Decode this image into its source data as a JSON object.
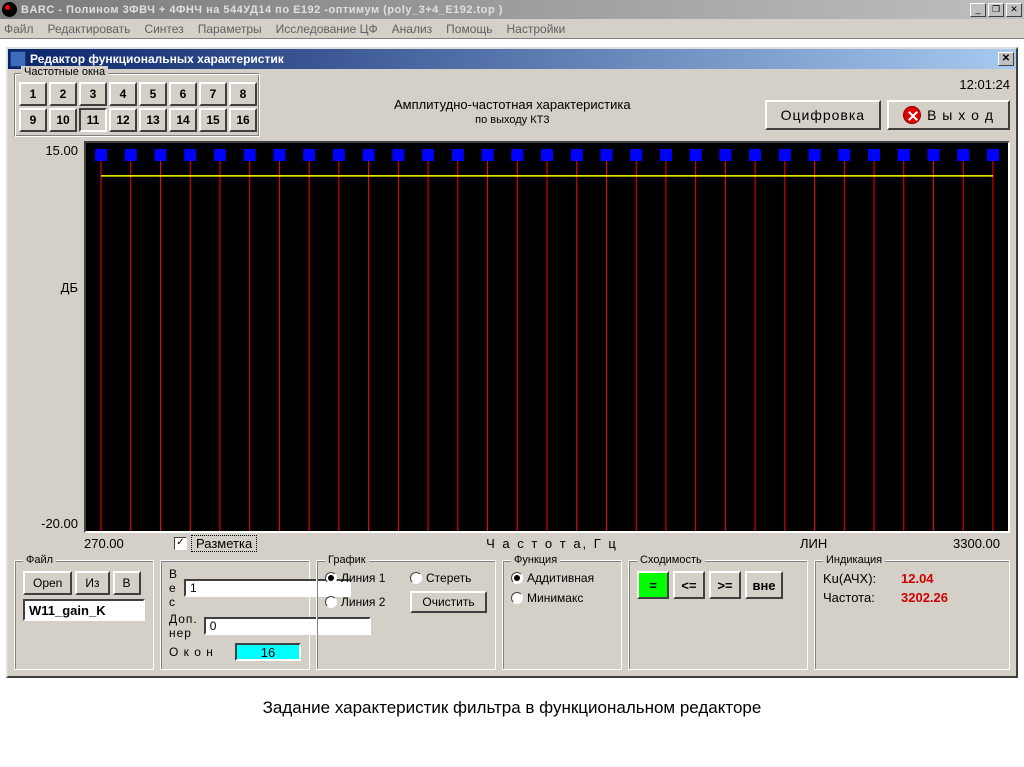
{
  "app_title": "BARC  -  Полином 3ФВЧ + 4ФНЧ на 544УД14 по Е192 -оптимум (poly_3+4_E192.top )",
  "menu": [
    "Файл",
    "Редактировать",
    "Синтез",
    "Параметры",
    "Исследование ЦФ",
    "Анализ",
    "Помощь",
    "Настройки"
  ],
  "editor_title": "Редактор функциональных характеристик",
  "freq_windows_label": "Частотные окна",
  "freq_windows": [
    "1",
    "2",
    "3",
    "4",
    "5",
    "6",
    "7",
    "8",
    "9",
    "10",
    "11",
    "12",
    "13",
    "14",
    "15",
    "16"
  ],
  "freq_active": "11",
  "chart_title": "Амплитудно-частотная характеристика",
  "chart_subtitle": "по выходу КТ3",
  "clock": "12:01:24",
  "btn_digitize": "Оцифровка",
  "btn_exit": "В ы х о д",
  "chart_data": {
    "type": "line",
    "xlabel": "Ч а с т о т а, Г ц",
    "ylabel": "ДБ",
    "ylim": [
      -20.0,
      15.0
    ],
    "xlim": [
      270.0,
      3300.0
    ],
    "xscale": "ЛИН",
    "markup": "Разметка",
    "yticks": [
      "15.00",
      "-20.00"
    ],
    "gridlines_x_count": 30,
    "yellow_line_y": 12.04
  },
  "file_panel": {
    "label": "Файл",
    "open": "Open",
    "from": "Из",
    "to": "В",
    "filename": "W11_gain_K"
  },
  "weight": {
    "ves": "В е с",
    "ves_val": "1",
    "dop": "Доп. нер",
    "dop_val": "0",
    "okon": "О к о н",
    "okon_val": "16"
  },
  "graph_panel": {
    "label": "График",
    "line1": "Линия 1",
    "line2": "Линия 2",
    "erase": "Стереть",
    "clear": "Очистить"
  },
  "func_panel": {
    "label": "Функция",
    "additive": "Аддитивная",
    "minimax": "Минимакс"
  },
  "conv_panel": {
    "label": "Сходимость",
    "eq": "=",
    "le": "<=",
    "ge": ">=",
    "out": "вне"
  },
  "ind_panel": {
    "label": "Индикация",
    "ku_lbl": "Ku(АЧХ):",
    "ku_val": "12.04",
    "freq_lbl": "Частота:",
    "freq_val": "3202.26"
  },
  "caption": "Задание характеристик фильтра в функциональном редакторе"
}
